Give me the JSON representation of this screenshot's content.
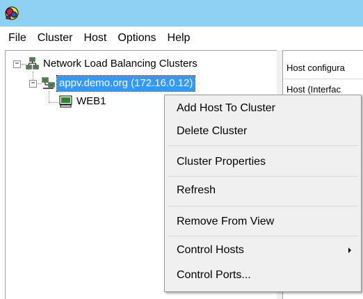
{
  "window": {
    "app_icon": "nlb-manager-icon",
    "title_bar_color": "#8fd1f2"
  },
  "menubar": {
    "items": [
      {
        "label": "File"
      },
      {
        "label": "Cluster"
      },
      {
        "label": "Host"
      },
      {
        "label": "Options"
      },
      {
        "label": "Help"
      }
    ]
  },
  "tree": {
    "root": {
      "label": "Network Load Balancing Clusters",
      "icon": "nlb-clusters-icon",
      "expanded": true
    },
    "cluster": {
      "label": "appv.demo.org (172.16.0.12)",
      "icon": "cluster-icon",
      "expanded": true,
      "selected": true
    },
    "host": {
      "label": "WEB1",
      "icon": "host-computer-icon"
    }
  },
  "right_pane": {
    "row1": "Host configura",
    "row2": "Host (Interfac"
  },
  "context_menu": {
    "items": [
      {
        "label": "Add Host To Cluster"
      },
      {
        "label": "Delete Cluster"
      },
      {
        "label": "Cluster Properties"
      },
      {
        "label": "Refresh"
      },
      {
        "label": "Remove From View"
      },
      {
        "label": "Control Hosts",
        "has_submenu": true
      },
      {
        "label": "Control Ports..."
      }
    ]
  },
  "colors": {
    "selection": "#3399ff",
    "menu_background": "#f0f0f0"
  }
}
